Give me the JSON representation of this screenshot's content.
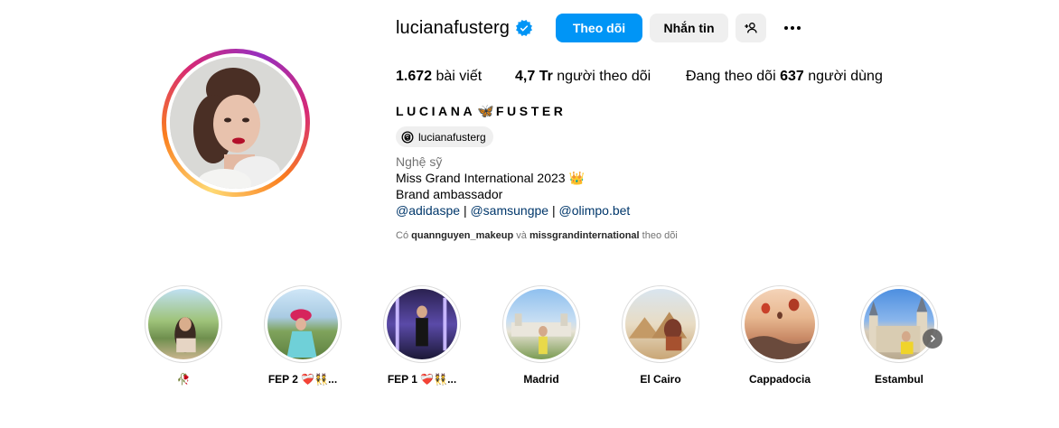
{
  "profile": {
    "username": "lucianafusterg",
    "follow_label": "Theo dõi",
    "message_label": "Nhắn tin",
    "posts_count": "1.672",
    "posts_label": "bài viết",
    "followers_count": "4,7 Tr",
    "followers_label": "người theo dõi",
    "following_prefix": "Đang theo dõi",
    "following_count": "637",
    "following_suffix": "người dùng",
    "fullname_left": "LUCIANA",
    "fullname_emoji": "🦋",
    "fullname_right": "FUSTER",
    "threads_handle": "lucianafusterg",
    "category": "Nghệ sỹ",
    "bio_line1": "Miss Grand International 2023 👑",
    "bio_line2": "Brand ambassador",
    "bio_mention1": "@adidaspe",
    "bio_mention2": "@samsungpe",
    "bio_mention3": "@olimpo.bet",
    "bio_sep": "|",
    "followed_by_prefix": "Có",
    "followed_by_user1": "quannguyen_makeup",
    "followed_by_and": "và",
    "followed_by_user2": "missgrandinternational",
    "followed_by_suffix": "theo dõi"
  },
  "highlights": [
    {
      "label": "🥀"
    },
    {
      "label": "FEP 2 ❤️‍🩹👯..."
    },
    {
      "label": "FEP 1 ❤️‍🩹👯..."
    },
    {
      "label": "Madrid"
    },
    {
      "label": "El Cairo"
    },
    {
      "label": "Cappadocia"
    },
    {
      "label": "Estambul"
    }
  ],
  "colors": {
    "accent": "#0095f6",
    "verified": "#0095f6",
    "link": "#00376b",
    "muted": "#737373",
    "button_bg": "#efefef"
  },
  "icons": {
    "verified": "verified-badge-icon",
    "add_user": "add-user-icon",
    "more": "more-horizontal-icon",
    "threads": "threads-icon",
    "next": "chevron-right-icon"
  }
}
